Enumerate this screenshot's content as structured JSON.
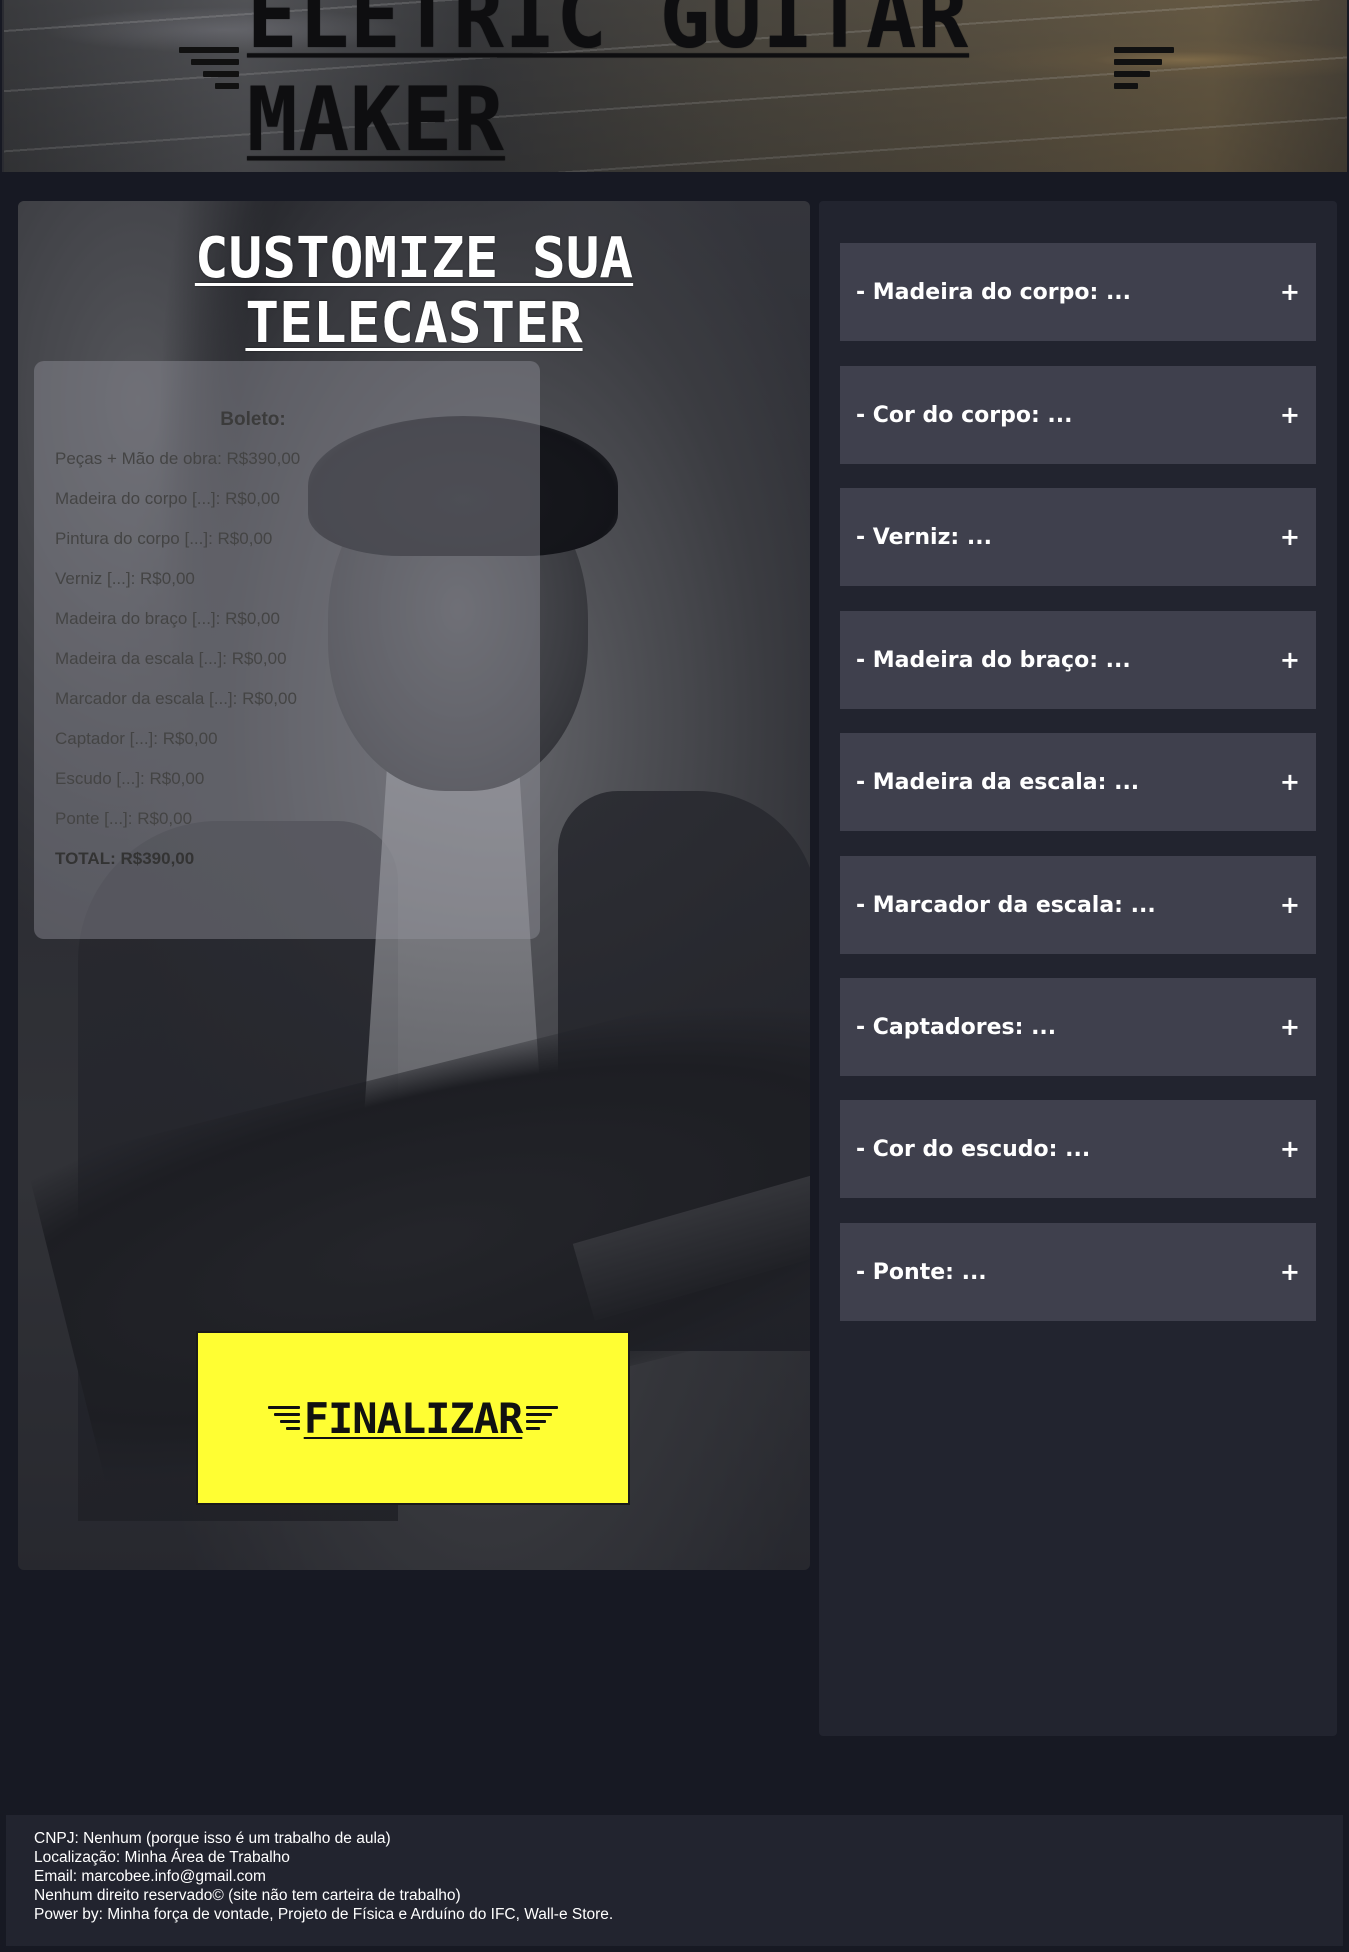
{
  "header": {
    "site_title": "ELETRIC GUITAR MAKER"
  },
  "customize": {
    "title": "CUSTOMIZE SUA TELECASTER"
  },
  "receipt": {
    "title": "Boleto:",
    "lines": [
      "Peças + Mão de obra: R$390,00",
      "Madeira do corpo [...]: R$0,00",
      "Pintura do corpo [...]: R$0,00",
      "Verniz [...]: R$0,00",
      "Madeira do braço [...]: R$0,00",
      "Madeira da escala [...]: R$0,00",
      "Marcador da escala [...]: R$0,00",
      "Captador [...]: R$0,00",
      "Escudo [...]: R$0,00",
      "Ponte [...]: R$0,00"
    ],
    "total_label": "TOTAL:",
    "total_value": "R$390,00"
  },
  "finalize": {
    "label": "FINALIZAR"
  },
  "options": [
    {
      "label": "- Madeira do corpo: ...",
      "icon": "+"
    },
    {
      "label": "- Cor do corpo: ...",
      "icon": "+"
    },
    {
      "label": "- Verniz: ...",
      "icon": "+"
    },
    {
      "label": "- Madeira do braço: ...",
      "icon": "+"
    },
    {
      "label": "- Madeira da escala: ...",
      "icon": "+"
    },
    {
      "label": "- Marcador da escala: ...",
      "icon": "+"
    },
    {
      "label": "- Captadores: ...",
      "icon": "+"
    },
    {
      "label": "- Cor do escudo: ...",
      "icon": "+"
    },
    {
      "label": "- Ponte: ...",
      "icon": "+"
    }
  ],
  "footer": {
    "lines": [
      "CNPJ: Nenhum (porque isso é um trabalho de aula)",
      "Localização: Minha Área de Trabalho",
      "Email: marcobee.info@gmail.com",
      "Nenhum direito reservado© (site não tem carteira de trabalho)",
      "Power by: Minha força de vontade, Projeto de Física e Arduíno do IFC, Wall-e Store."
    ]
  },
  "colors": {
    "page_bg": "#171923",
    "panel_bg": "#22242f",
    "option_bg": "#3f404d",
    "finalize_bg": "#fffe33"
  }
}
